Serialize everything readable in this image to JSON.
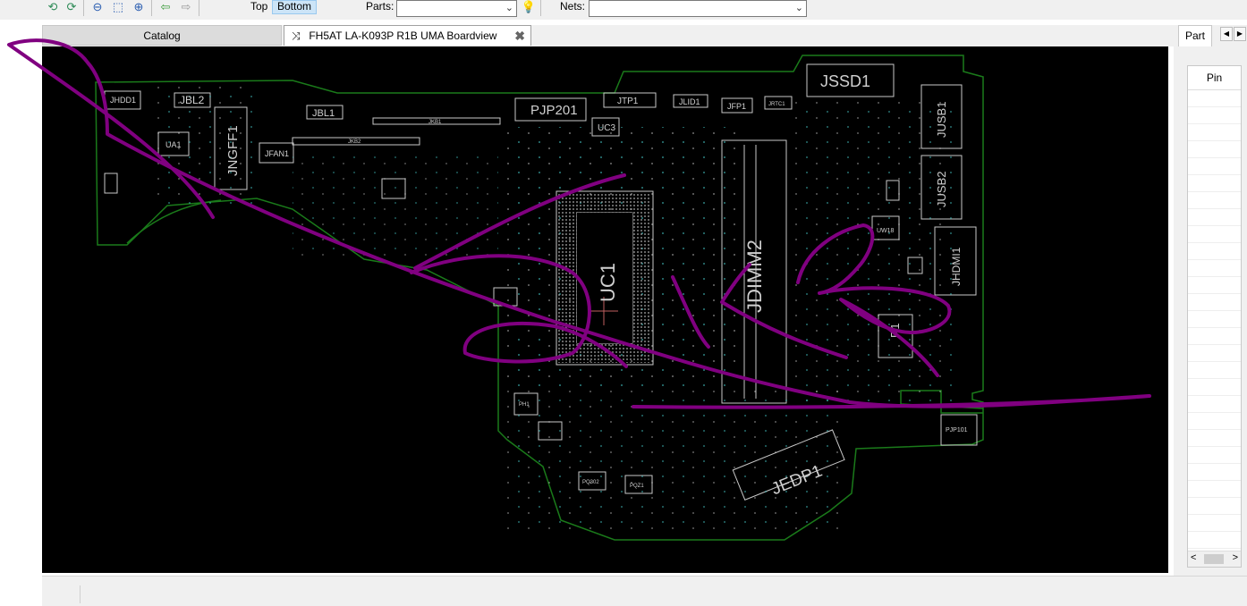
{
  "toolbar": {
    "icons": [
      "refresh-icon",
      "rotate-icon",
      "zoom-out-icon",
      "fit-icon",
      "zoom-in-icon",
      "back-arrow-icon",
      "forward-arrow-icon"
    ],
    "side_top_label": "Top",
    "side_bottom_label": "Bottom",
    "parts_label": "Parts:",
    "parts_value": "",
    "nets_label": "Nets:",
    "nets_value": ""
  },
  "tabs": {
    "catalog": "Catalog",
    "board": "FH5AT LA-K093P R1B UMA Boardview"
  },
  "board": {
    "board_outline_color": "#1a7a1a",
    "component_color": "#c8c8c8",
    "labels": {
      "jhdd1": "JHDD1",
      "jbl2": "JBL2",
      "jbl1": "JBL1",
      "jngff1": "JNGFF1",
      "ua1": "UA1",
      "jfan1": "JFAN1",
      "jkb1": "JKB1",
      "jkb2": "JKB2",
      "pjp201": "PJP201",
      "jtp1": "JTP1",
      "jlid1": "JLID1",
      "jfp1": "JFP1",
      "jrtc1": "JRTC1",
      "uc3": "UC3",
      "jssd1": "JSSD1",
      "jusb1": "JUSB1",
      "jusb2": "JUSB2",
      "uc1": "UC1",
      "jdimm2": "JDIMM2",
      "uw18": "UW18",
      "jhdmi1": "JHDMI1",
      "r1": "R1",
      "pjp101": "PJP101",
      "jedp1": "JEDP1",
      "pq302": "PQ302",
      "pqz1": "PQZ1",
      "ph1": "PH1"
    }
  },
  "right_panel": {
    "tab_label": "Part",
    "grid_header": "Pin",
    "scroll_left": "<",
    "scroll_right": ">"
  },
  "overlay": {
    "stroke_color": "#800080"
  }
}
